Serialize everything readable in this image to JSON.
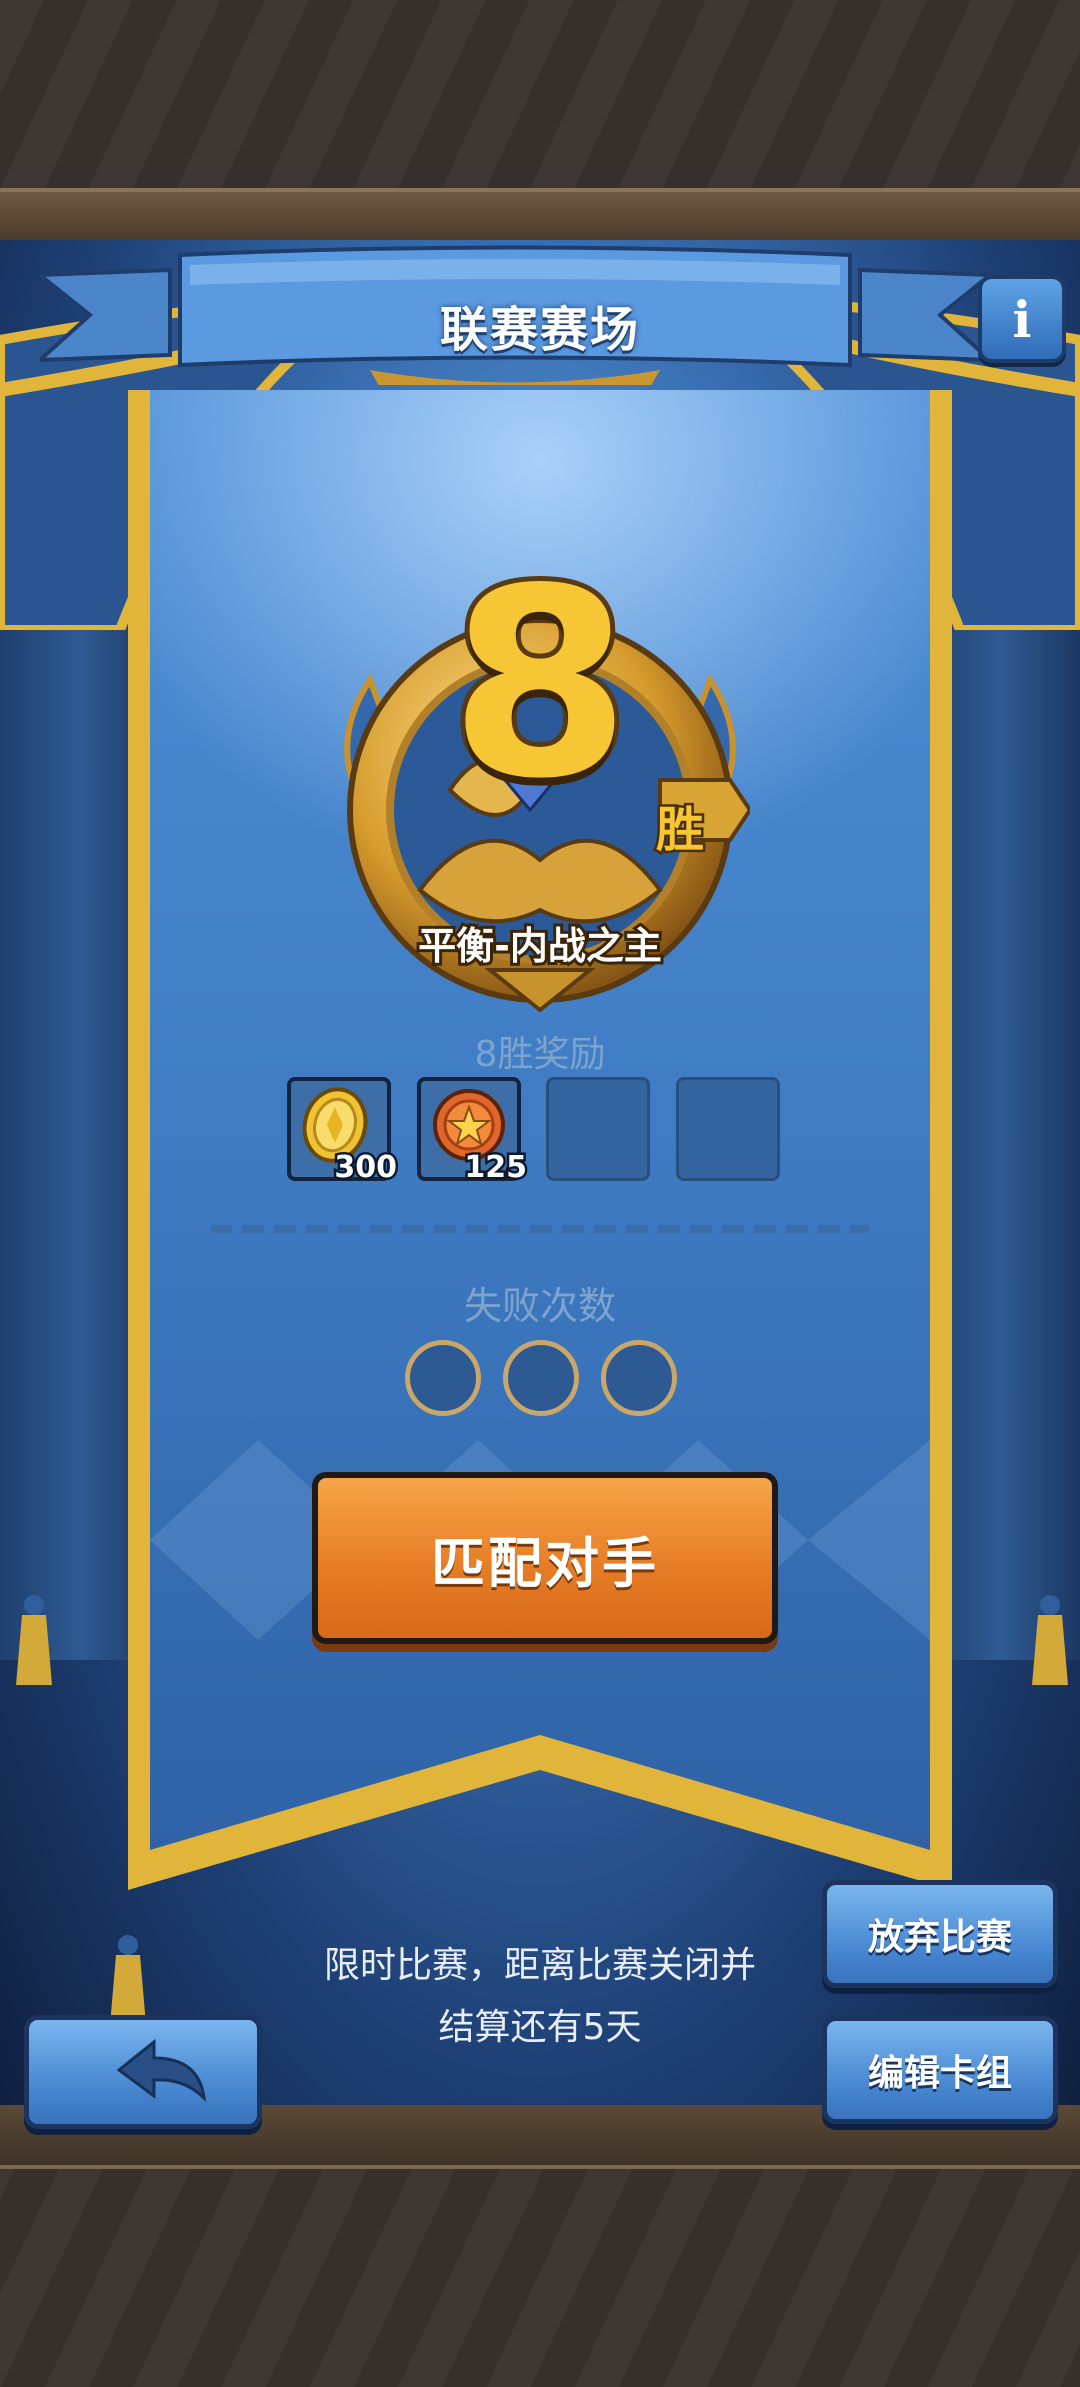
{
  "header": {
    "title": "联赛赛场",
    "info_icon": "info-icon"
  },
  "rank": {
    "wins": "8",
    "wins_suffix": "胜",
    "name": "平衡-内战之主"
  },
  "rewards": {
    "title": "8胜奖励",
    "items": [
      {
        "icon": "gold-coin-icon",
        "count": "300"
      },
      {
        "icon": "star-medal-icon",
        "count": "125"
      },
      {
        "icon": "",
        "count": ""
      },
      {
        "icon": "",
        "count": ""
      }
    ]
  },
  "losses": {
    "title": "失败次数",
    "max": 3,
    "used": 0
  },
  "actions": {
    "match_label": "匹配对手",
    "abandon_label": "放弃比赛",
    "edit_deck_label": "编辑卡组",
    "back_icon": "back-arrow-icon"
  },
  "notice": {
    "line1": "限时比赛，距离比赛关闭并",
    "line2": "结算还有5天"
  },
  "colors": {
    "gold": "#f6c634",
    "banner_blue": "#3b72b5",
    "orange_button": "#e57a24",
    "side_button": "#4584cf"
  }
}
